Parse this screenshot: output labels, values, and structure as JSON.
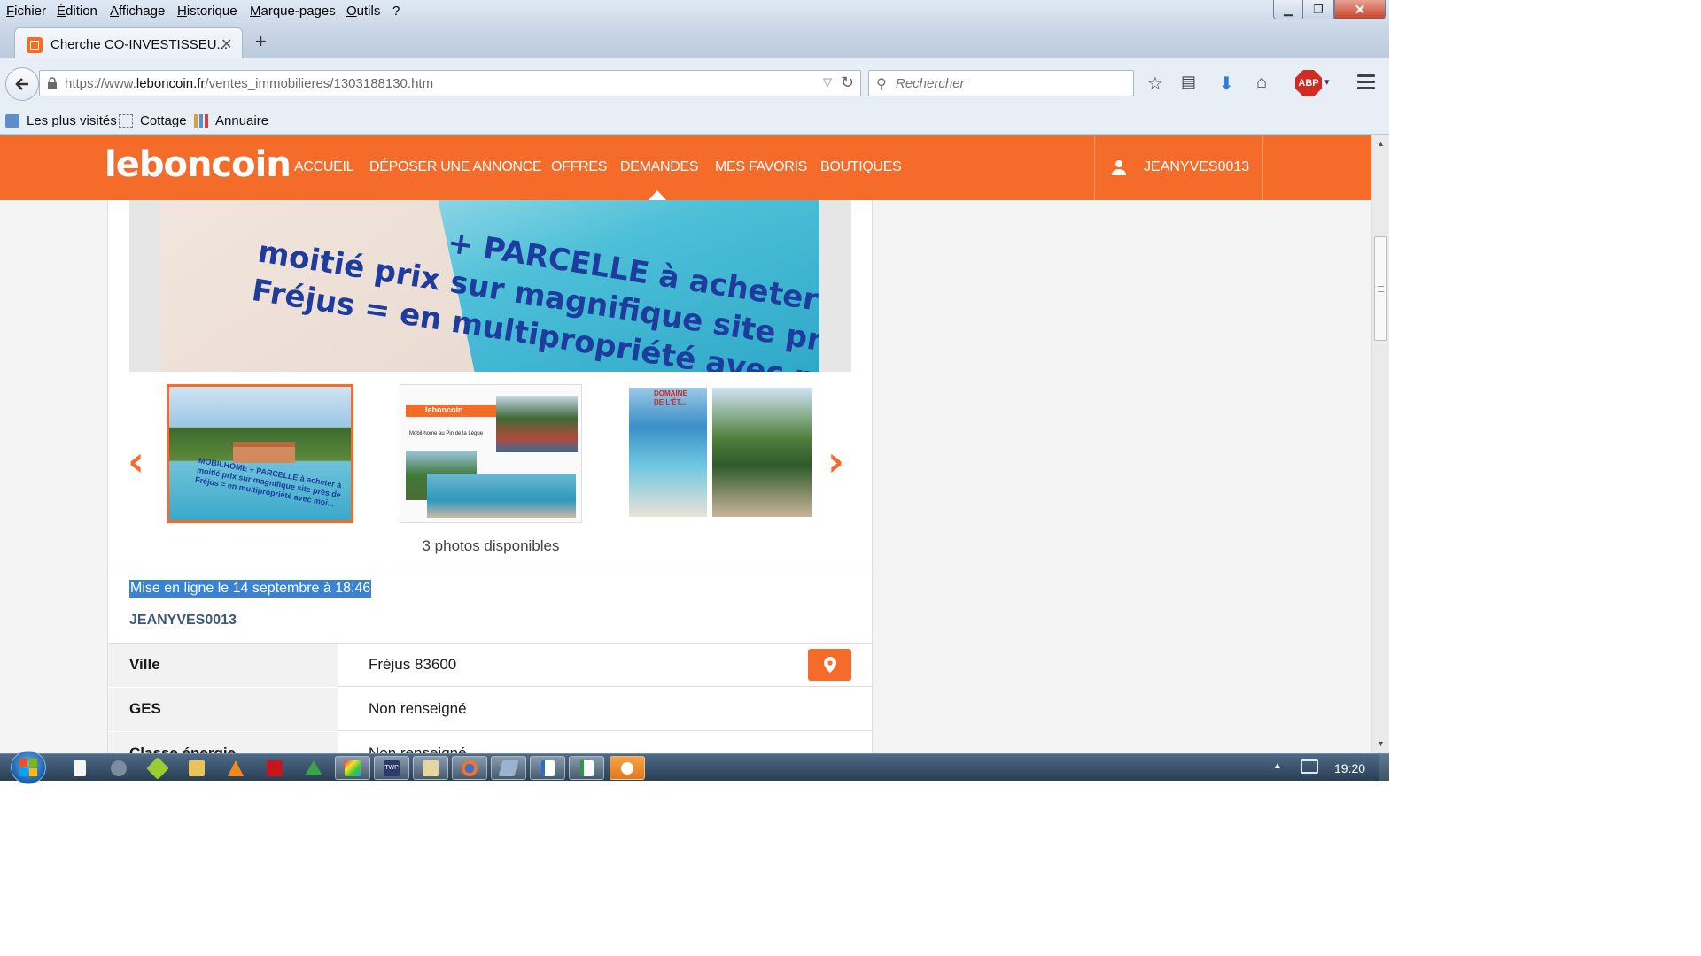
{
  "menubar": {
    "items": [
      "Fichier",
      "Édition",
      "Affichage",
      "Historique",
      "Marque-pages",
      "Outils",
      "?"
    ]
  },
  "tab": {
    "title": "Cherche CO-INVESTISSEU...",
    "close": "✕"
  },
  "nav": {
    "url_prefix": "https://www.",
    "url_host": "leboncoin.fr",
    "url_path": "/ventes_immobilieres/1303188130.htm",
    "search_placeholder": "Rechercher"
  },
  "bookmarks": [
    "Les plus visités",
    "Cottage",
    "Annuaire"
  ],
  "site": {
    "logo": "leboncoin",
    "nav_links": [
      "ACCUEIL",
      "DÉPOSER UNE ANNONCE",
      "OFFRES",
      "DEMANDES",
      "MES FAVORIS",
      "BOUTIQUES"
    ],
    "active_link": "DEMANDES",
    "username": "JEANYVES0013",
    "brand_color": "#f56b2a"
  },
  "listing": {
    "main_photo_text": [
      "+ PARCELLE à acheter à",
      "moitié prix sur magnifique site près de",
      "Fréjus = en multipropriété avec moi..."
    ],
    "thumbs": [
      {
        "label": "photo 1",
        "text": [
          "MOBILHOME + PARCELLE à acheter à",
          "moitié prix sur magnifique site près de",
          "Fréjus = en multipropriété avec moi..."
        ]
      },
      {
        "label": "photo 2",
        "logo": "leboncoin",
        "text": "Mobil-home au Pin de la Légue"
      },
      {
        "label": "photo 3",
        "text": [
          "DOMAINE",
          "DE L'ÉT..."
        ]
      }
    ],
    "photos_count": "3 photos disponibles",
    "post_date": "Mise en ligne le 14 septembre à 18:46",
    "seller": "JEANYVES0013",
    "properties": [
      {
        "label": "Ville",
        "value": "Fréjus 83600"
      },
      {
        "label": "GES",
        "value": "Non renseigné"
      },
      {
        "label": "Classe énergie",
        "value": "Non renseigné"
      }
    ]
  },
  "taskbar": {
    "clock": "19:20",
    "apps": [
      "blank-doc",
      "network-tool",
      "gaming-app",
      "file-explorer",
      "vlc",
      "pdf-reader",
      "triangle-app",
      "paint-app",
      "twp-app",
      "notes-app",
      "firefox",
      "hardware-app",
      "writer",
      "calc",
      "sync-app"
    ],
    "twp_label": "TWP"
  }
}
